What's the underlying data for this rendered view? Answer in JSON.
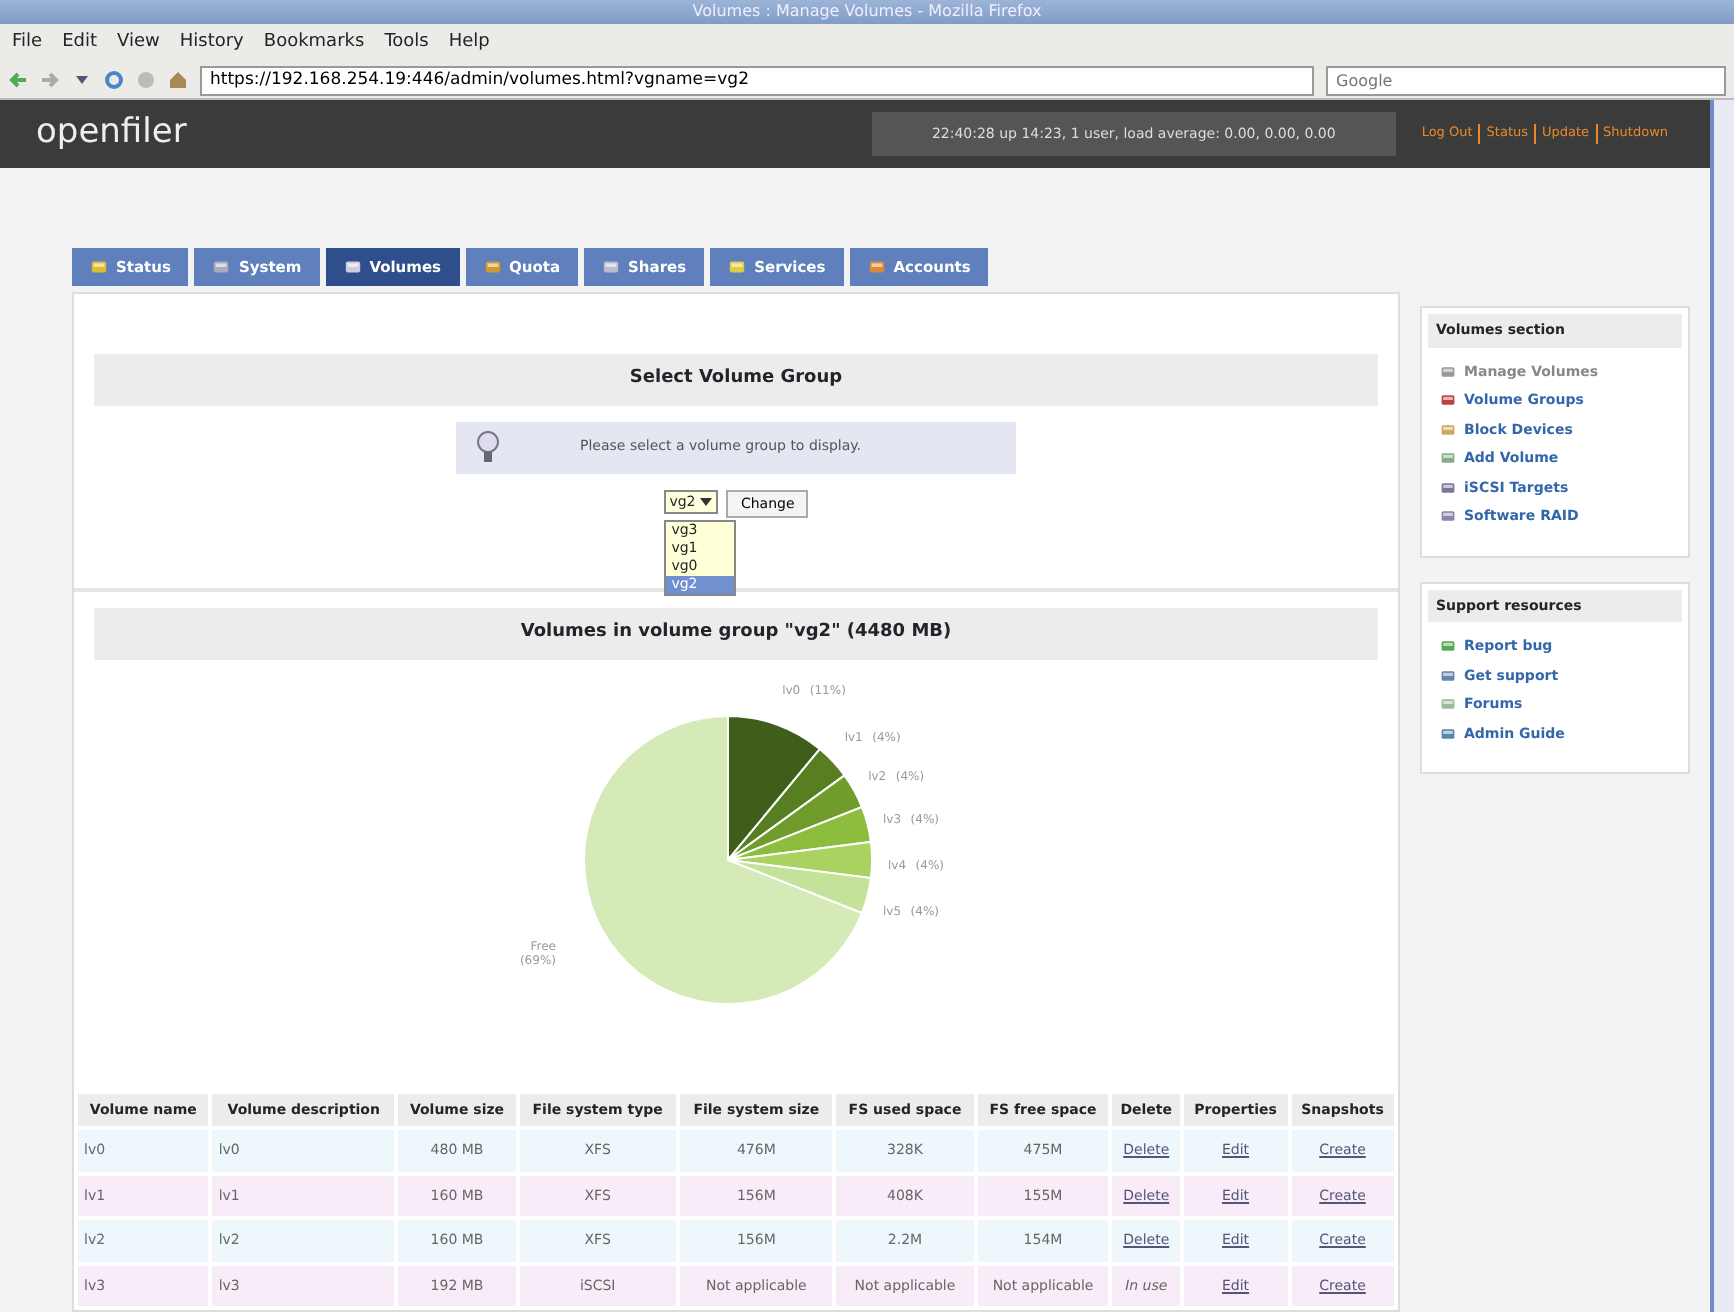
{
  "window": {
    "title": "Volumes : Manage Volumes - Mozilla Firefox"
  },
  "menu_bar": [
    "File",
    "Edit",
    "View",
    "History",
    "Bookmarks",
    "Tools",
    "Help"
  ],
  "address_bar": {
    "value": "https://192.168.254.19:446/admin/volumes.html?vgname=vg2"
  },
  "search_field": {
    "placeholder": "Google"
  },
  "header": {
    "logo": "openfiler",
    "status": "22:40:28 up 14:23, 1 user, load average: 0.00, 0.00, 0.00",
    "links": [
      "Log Out",
      "Status",
      "Update",
      "Shutdown"
    ]
  },
  "tabs": [
    {
      "label": "Status",
      "selected": false
    },
    {
      "label": "System",
      "selected": false
    },
    {
      "label": "Volumes",
      "selected": true
    },
    {
      "label": "Quota",
      "selected": false
    },
    {
      "label": "Shares",
      "selected": false
    },
    {
      "label": "Services",
      "selected": false
    },
    {
      "label": "Accounts",
      "selected": false
    }
  ],
  "select_section": {
    "title": "Select Volume Group",
    "message": "Please select a volume group to display.",
    "select_value": "vg2",
    "options": [
      {
        "label": "vg3",
        "selected": false
      },
      {
        "label": "vg1",
        "selected": false
      },
      {
        "label": "vg0",
        "selected": false
      },
      {
        "label": "vg2",
        "selected": true
      }
    ],
    "button": "Change"
  },
  "volumes_section": {
    "title": "Volumes in volume group \"vg2\" (4480 MB)",
    "chart_data": {
      "type": "pie",
      "categories": [
        "lv0",
        "lv1",
        "lv2",
        "lv3",
        "lv4",
        "lv5",
        "Free"
      ],
      "values": [
        11,
        4,
        4,
        4,
        4,
        4,
        69
      ],
      "data_labels": "value_labels",
      "value_labels": [
        "(11%)",
        "(4%)",
        "(4%)",
        "(4%)",
        "(4%)",
        "(4%)",
        "(69%)"
      ]
    }
  },
  "table": {
    "columns": [
      "Volume name",
      "Volume description",
      "Volume size",
      "File system type",
      "File system size",
      "FS used space",
      "FS free space",
      "Delete",
      "Properties",
      "Snapshots"
    ],
    "rows": [
      {
        "cells": [
          "lv0",
          "lv0",
          "480 MB",
          "XFS",
          "476M",
          "328K",
          "475M"
        ],
        "delete": {
          "kind": "link",
          "text": "Delete"
        },
        "properties": "Edit",
        "snapshots": "Create"
      },
      {
        "cells": [
          "lv1",
          "lv1",
          "160 MB",
          "XFS",
          "156M",
          "408K",
          "155M"
        ],
        "delete": {
          "kind": "link",
          "text": "Delete"
        },
        "properties": "Edit",
        "snapshots": "Create"
      },
      {
        "cells": [
          "lv2",
          "lv2",
          "160 MB",
          "XFS",
          "156M",
          "2.2M",
          "154M"
        ],
        "delete": {
          "kind": "link",
          "text": "Delete"
        },
        "properties": "Edit",
        "snapshots": "Create"
      },
      {
        "cells": [
          "lv3",
          "lv3",
          "192 MB",
          "iSCSI",
          "Not applicable",
          "Not applicable",
          "Not applicable"
        ],
        "delete": {
          "kind": "note",
          "text": "In use"
        },
        "properties": "Edit",
        "snapshots": "Create"
      }
    ]
  },
  "sidebar": [
    {
      "title": "Volumes section",
      "items": [
        {
          "label": "Manage Volumes",
          "selected": true
        },
        {
          "label": "Volume Groups",
          "selected": false
        },
        {
          "label": "Block Devices",
          "selected": false
        },
        {
          "label": "Add Volume",
          "selected": false
        },
        {
          "label": "iSCSI Targets",
          "selected": false
        },
        {
          "label": "Software RAID",
          "selected": false
        }
      ]
    },
    {
      "title": "Support resources",
      "items": [
        {
          "label": "Report bug",
          "selected": false
        },
        {
          "label": "Get support",
          "selected": false
        },
        {
          "label": "Forums",
          "selected": false
        },
        {
          "label": "Admin Guide",
          "selected": false
        }
      ]
    }
  ]
}
